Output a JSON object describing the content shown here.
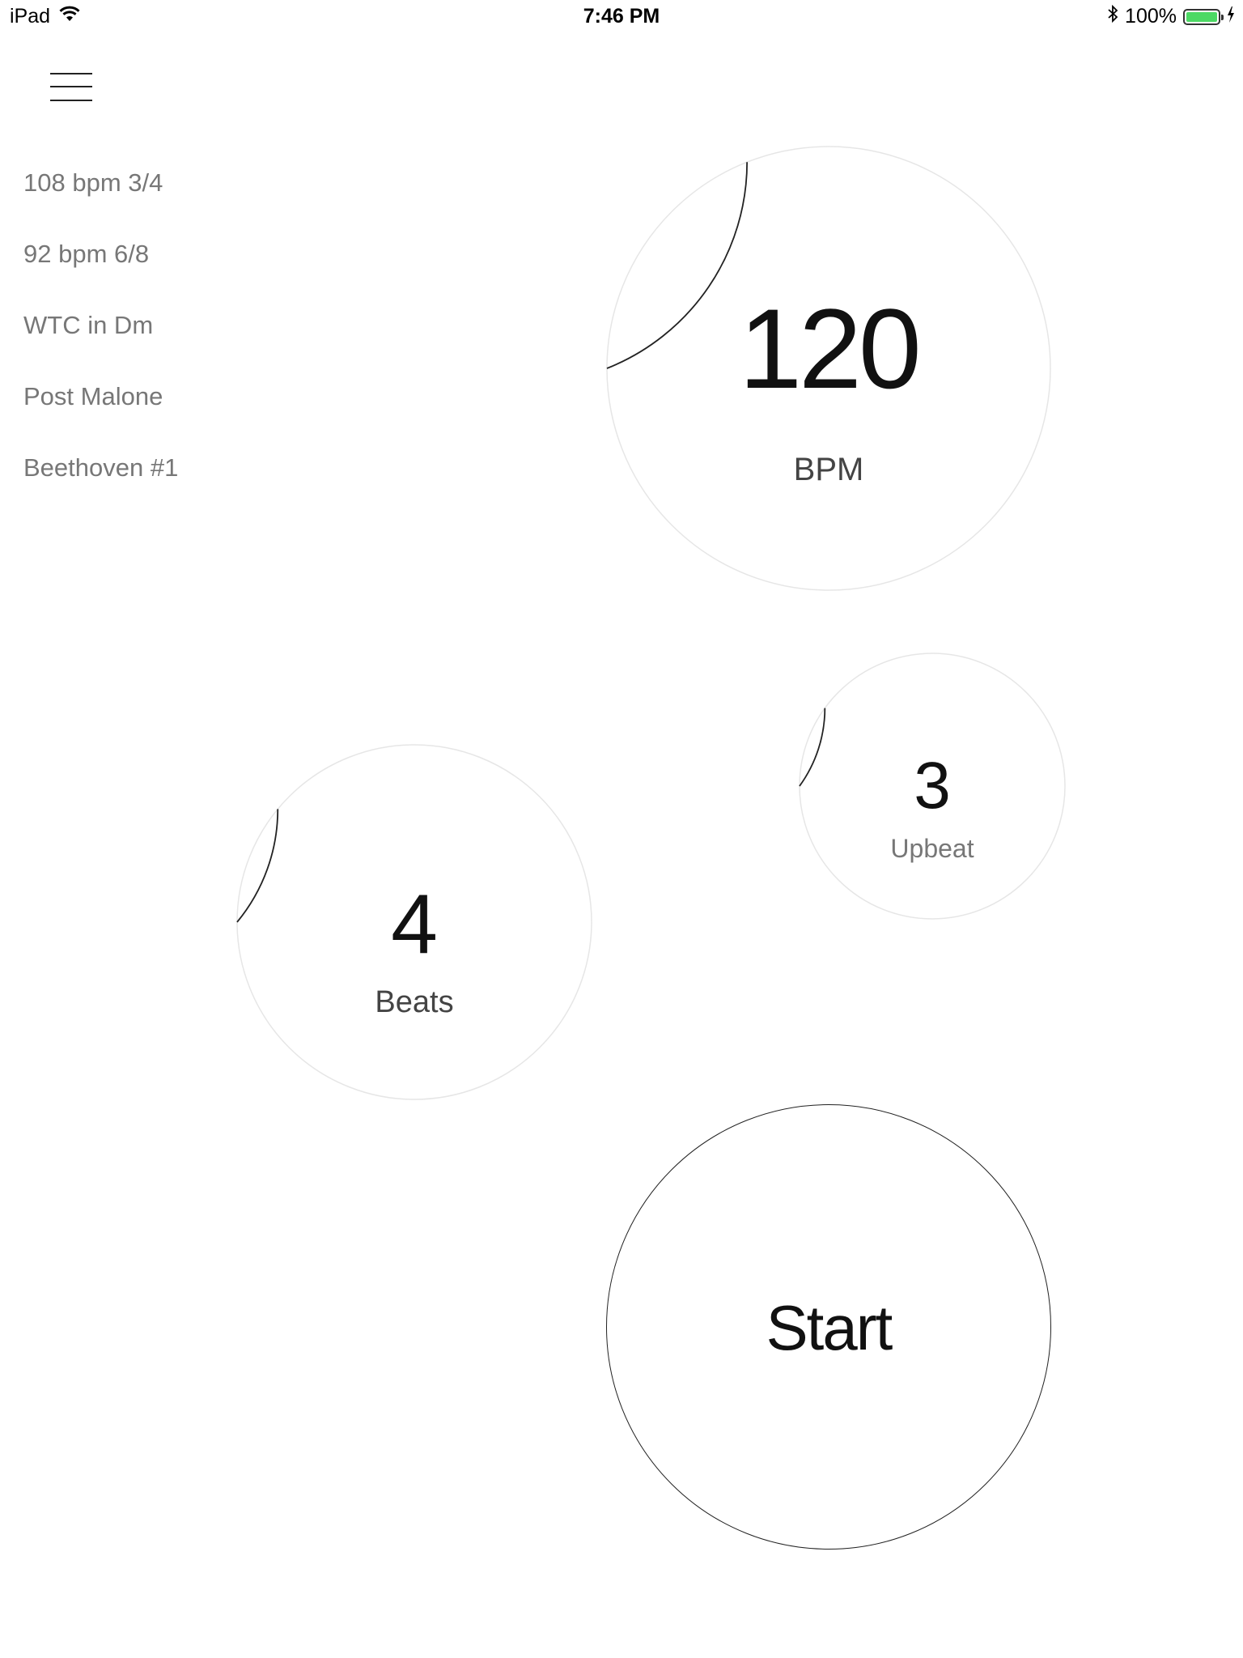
{
  "status_bar": {
    "device": "iPad",
    "time": "7:46 PM",
    "battery_percent": "100%",
    "battery_level": 1.0,
    "battery_color": "#4cd964",
    "wifi_icon": "wifi-icon",
    "bluetooth_icon": "bluetooth-icon",
    "charging_icon": "charging-bolt-icon"
  },
  "menu": {
    "icon": "hamburger-menu-icon"
  },
  "presets": [
    {
      "label": "108 bpm 3/4"
    },
    {
      "label": "92 bpm 6/8"
    },
    {
      "label": "WTC in Dm"
    },
    {
      "label": "Post Malone"
    },
    {
      "label": "Beethoven #1"
    }
  ],
  "bpm": {
    "value": "120",
    "label": "BPM",
    "arc_fraction": 0.19
  },
  "upbeat": {
    "value": "3",
    "label": "Upbeat",
    "arc_fraction": 0.1
  },
  "beats": {
    "value": "4",
    "label": "Beats",
    "arc_fraction": 0.11
  },
  "start": {
    "label": "Start"
  }
}
